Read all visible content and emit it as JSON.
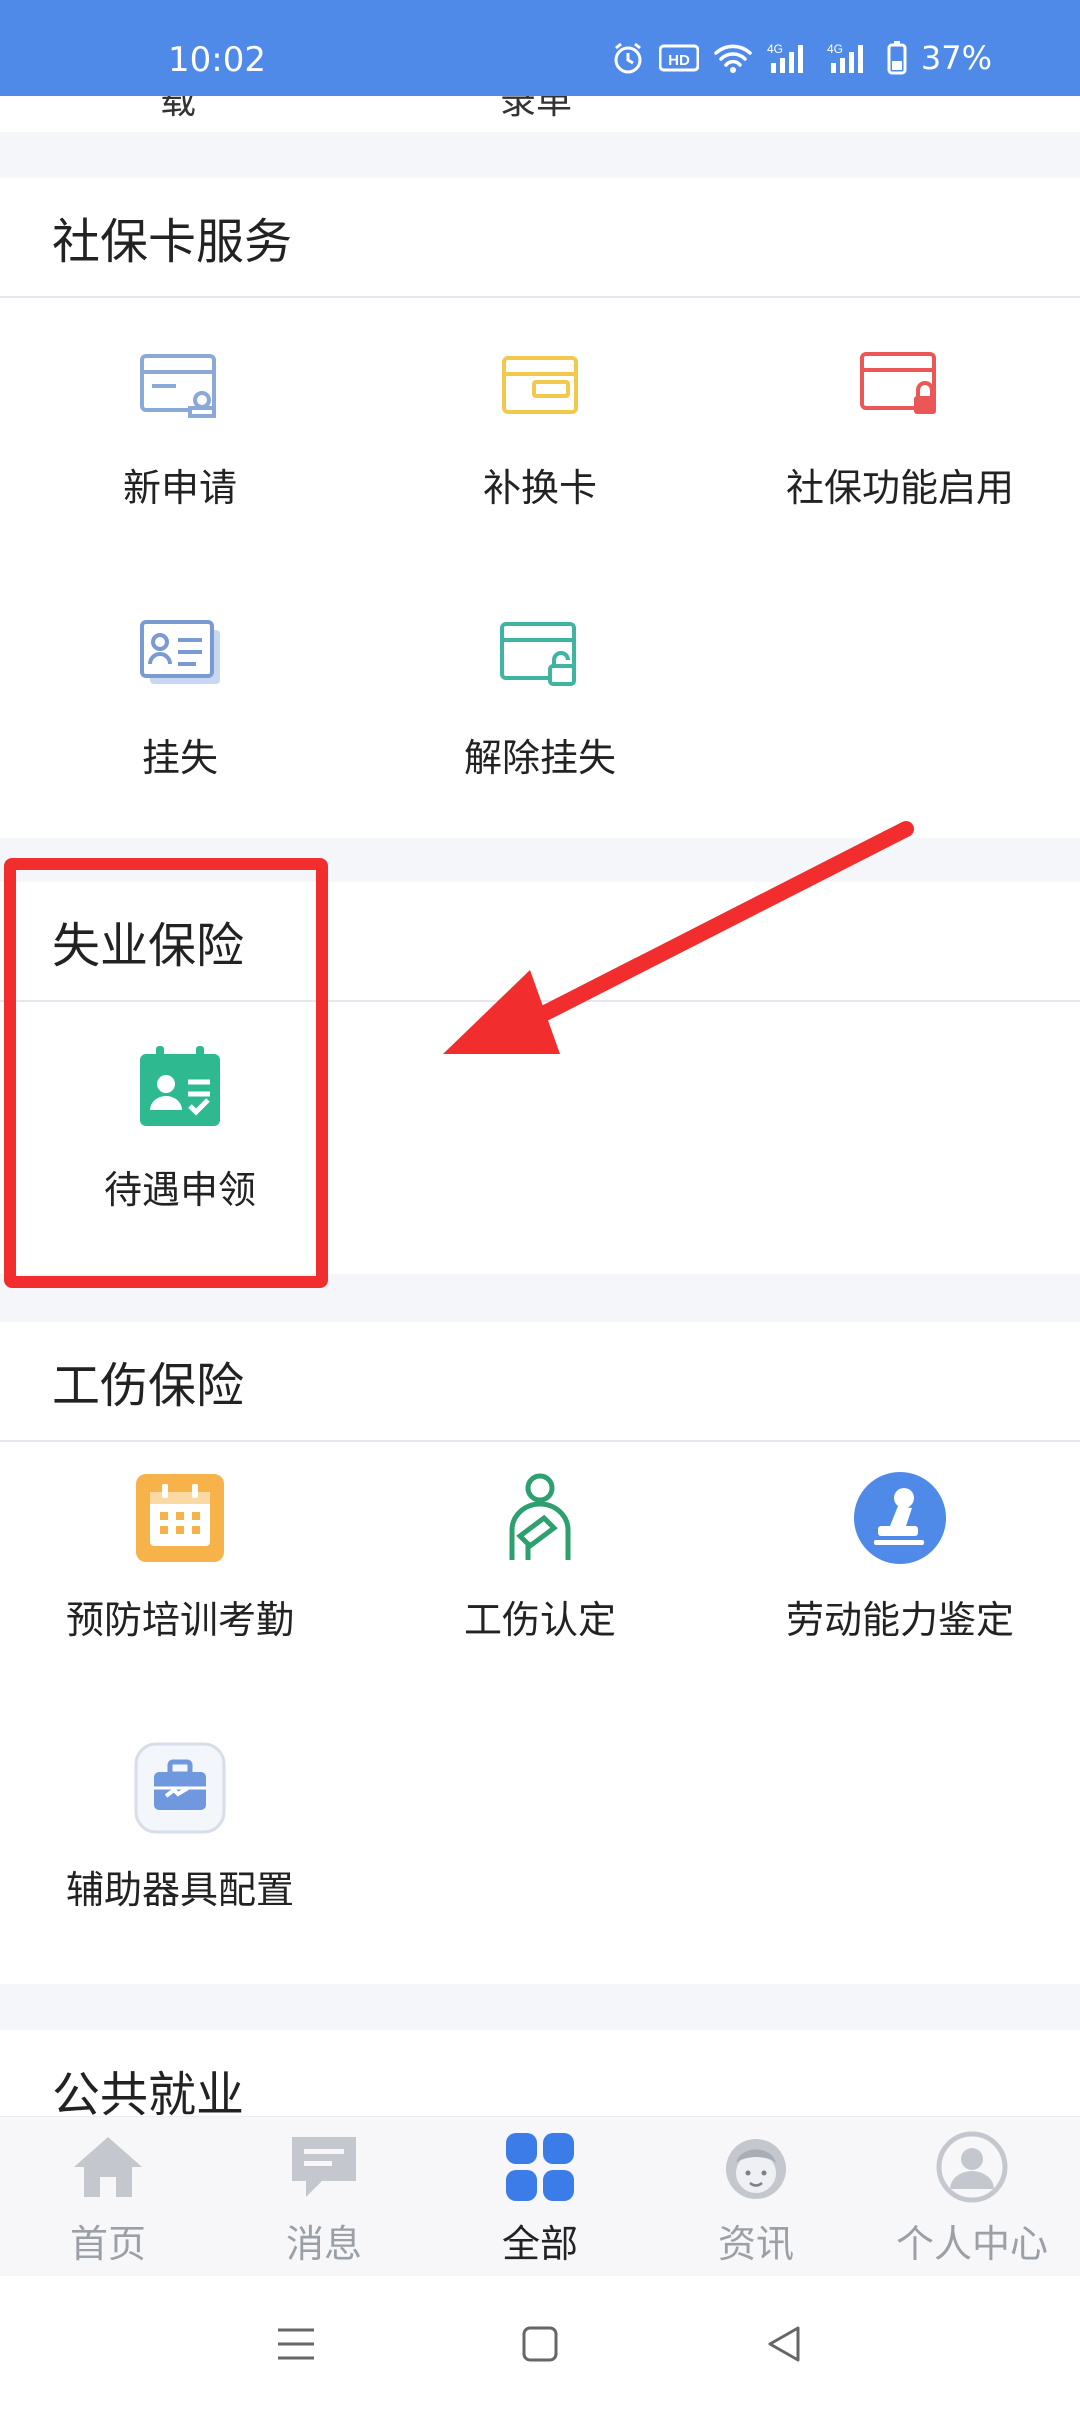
{
  "status_bar": {
    "time": "10:02",
    "battery": "37%"
  },
  "partial_labels": [
    "载",
    "录单"
  ],
  "sections": {
    "social_card": {
      "title": "社保卡服务",
      "items": [
        {
          "label": "新申请",
          "icon": "card-stamp-icon"
        },
        {
          "label": "补换卡",
          "icon": "card-icon"
        },
        {
          "label": "社保功能启用",
          "icon": "card-lock-icon"
        },
        {
          "label": "挂失",
          "icon": "id-card-icon"
        },
        {
          "label": "解除挂失",
          "icon": "card-unlock-icon"
        }
      ]
    },
    "unemployment": {
      "title": "失业保险",
      "items": [
        {
          "label": "待遇申领",
          "icon": "calendar-user-icon"
        }
      ]
    },
    "injury": {
      "title": "工伤保险",
      "items": [
        {
          "label": "预防培训考勤",
          "icon": "calendar-icon"
        },
        {
          "label": "工伤认定",
          "icon": "injured-person-icon"
        },
        {
          "label": "劳动能力鉴定",
          "icon": "stamp-icon"
        },
        {
          "label": "辅助器具配置",
          "icon": "toolbox-icon"
        }
      ]
    },
    "employment": {
      "title": "公共就业"
    }
  },
  "tabs": [
    {
      "label": "首页",
      "icon": "home-icon"
    },
    {
      "label": "消息",
      "icon": "message-icon"
    },
    {
      "label": "全部",
      "icon": "grid-icon",
      "active": true
    },
    {
      "label": "资讯",
      "icon": "news-person-icon"
    },
    {
      "label": "个人中心",
      "icon": "user-icon"
    }
  ],
  "colors": {
    "status_bar": "#4f8ae9",
    "annotation": "#f22d2d",
    "active_tab": "#3b7ce8"
  }
}
